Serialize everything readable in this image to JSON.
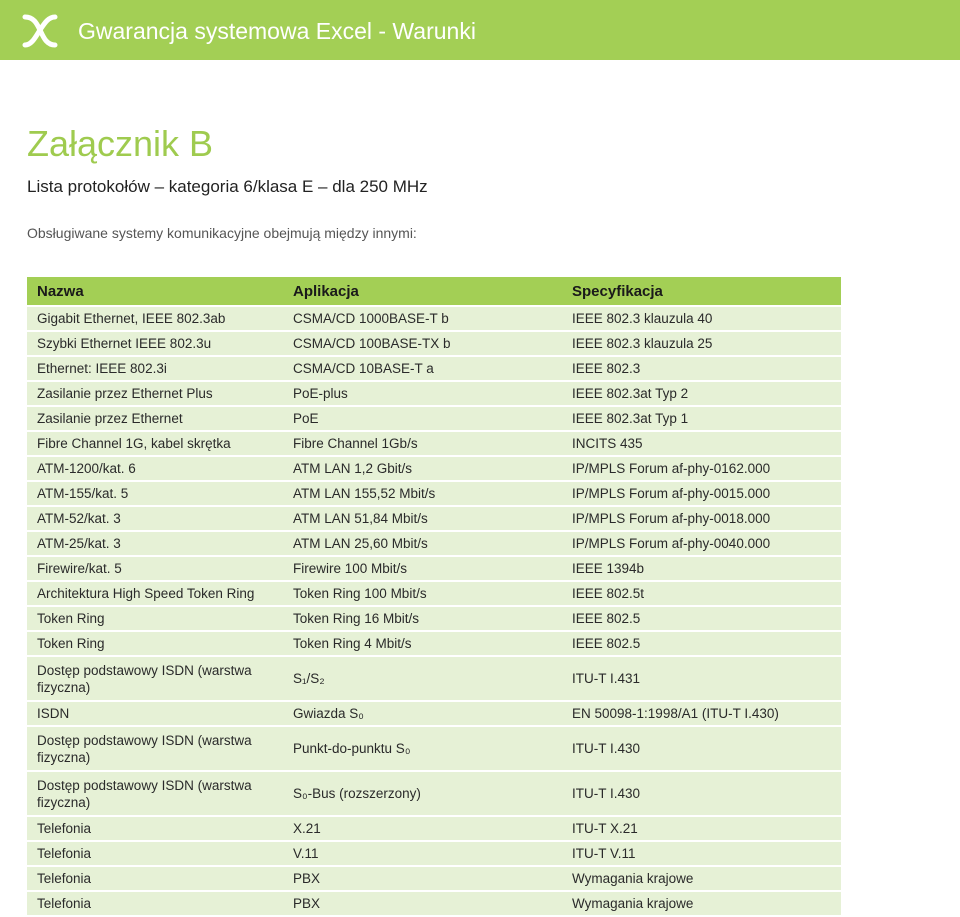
{
  "header": {
    "logo_icon": "x-logo-icon",
    "title": "Gwarancja systemowa Excel - Warunki",
    "background": "#a3cf55"
  },
  "annex": {
    "title": "Załącznik B",
    "subtitle": "Lista protokołów – kategoria 6/klasa E – dla 250 MHz",
    "intro": "Obsługiwane systemy komunikacyjne obejmują między innymi:"
  },
  "table": {
    "columns": [
      "Nazwa",
      "Aplikacja",
      "Specyfikacja"
    ],
    "rows": [
      [
        "Gigabit Ethernet, IEEE 802.3ab",
        "CSMA/CD 1000BASE-T b",
        "IEEE 802.3 klauzula 40"
      ],
      [
        "Szybki Ethernet IEEE 802.3u",
        "CSMA/CD 100BASE-TX b",
        "IEEE 802.3 klauzula 25"
      ],
      [
        "Ethernet: IEEE 802.3i",
        "CSMA/CD 10BASE-T a",
        "IEEE 802.3"
      ],
      [
        "Zasilanie przez Ethernet Plus",
        "PoE-plus",
        "IEEE 802.3at Typ 2"
      ],
      [
        "Zasilanie przez Ethernet",
        "PoE",
        "IEEE 802.3at Typ 1"
      ],
      [
        "Fibre Channel 1G, kabel skrętka",
        "Fibre Channel 1Gb/s",
        "INCITS 435"
      ],
      [
        "ATM-1200/kat. 6",
        "ATM LAN 1,2 Gbit/s",
        "IP/MPLS Forum af-phy-0162.000"
      ],
      [
        "ATM-155/kat. 5",
        "ATM LAN 155,52 Mbit/s",
        "IP/MPLS Forum af-phy-0015.000"
      ],
      [
        "ATM-52/kat. 3",
        "ATM LAN 51,84 Mbit/s",
        "IP/MPLS Forum af-phy-0018.000"
      ],
      [
        "ATM-25/kat. 3",
        "ATM LAN 25,60 Mbit/s",
        "IP/MPLS Forum af-phy-0040.000"
      ],
      [
        "Firewire/kat. 5",
        "Firewire 100 Mbit/s",
        "IEEE 1394b"
      ],
      [
        "Architektura High Speed Token Ring",
        "Token Ring 100 Mbit/s",
        "IEEE 802.5t"
      ],
      [
        "Token Ring",
        "Token Ring 16 Mbit/s",
        "IEEE 802.5"
      ],
      [
        "Token Ring",
        "Token Ring 4 Mbit/s",
        "IEEE 802.5"
      ],
      [
        "Dostęp podstawowy ISDN (warstwa fizyczna)",
        "S₁/S₂",
        "ITU-T I.431"
      ],
      [
        "ISDN",
        "Gwiazda S₀",
        "EN 50098-1:1998/A1 (ITU-T I.430)"
      ],
      [
        "Dostęp podstawowy ISDN (warstwa fizyczna)",
        "Punkt-do-punktu S₀",
        "ITU-T I.430"
      ],
      [
        "Dostęp podstawowy ISDN (warstwa fizyczna)",
        "S₀-Bus (rozszerzony)",
        "ITU-T I.430"
      ],
      [
        "Telefonia",
        "X.21",
        "ITU-T X.21"
      ],
      [
        "Telefonia",
        "V.11",
        "ITU-T V.11"
      ],
      [
        "Telefonia",
        "PBX",
        "Wymagania krajowe"
      ],
      [
        "Telefonia",
        "PBX",
        "Wymagania krajowe"
      ]
    ]
  }
}
